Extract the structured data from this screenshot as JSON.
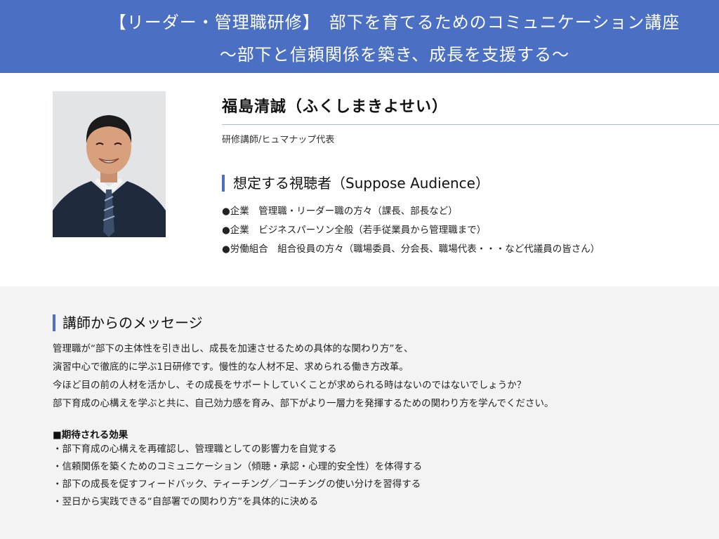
{
  "header": {
    "title_line1": "【リーダー・管理職研修】　部下を育てるためのコミュニケーション講座",
    "title_line2": "〜部下と信頼関係を築き、成長を支援する〜"
  },
  "instructor": {
    "name": "福島清誠（ふくしまきよせい）",
    "title": "研修講師/ヒュマナップ代表"
  },
  "audience": {
    "heading": "想定する視聴者（Suppose Audience）",
    "items": [
      "●企業　管理職・リーダー職の方々（課長、部長など）",
      "●企業　ビジネスパーソン全般（若手従業員から管理職まで）",
      "●労働組合　組合役員の方々（職場委員、分会長、職場代表・・・など代議員の皆さん）"
    ]
  },
  "message": {
    "heading": "講師からのメッセージ",
    "paragraphs": [
      "管理職が“部下の主体性を引き出し、成長を加速させるための具体的な関わり方”を、",
      "演習中心で徹底的に学ぶ1日研修です。慢性的な人材不足、求められる働き方改革。",
      "今ほど目の前の人材を活かし、その成長をサポートしていくことが求められる時はないのではないでしょうか？",
      "部下育成の心構えを学ぶと共に、自己効力感を育み、部下がより一層力を発揮するための関わり方を学んでください。"
    ],
    "effects_title": "■期待される効果",
    "effects": [
      "・部下育成の心構えを再確認し、管理職としての影響力を自覚する",
      "・信頼関係を築くためのコミュニケーション（傾聴・承認・心理的安全性）を体得する",
      "・部下の成長を促すフィードバック、ティーチング／コーチングの使い分けを習得する",
      "・翌日から実践できる“自部署での関わり方”を具体的に決める"
    ]
  },
  "colors": {
    "banner": "#4a6fc3",
    "accent": "#4a6fc3",
    "message_bg": "#f3f3f3"
  }
}
